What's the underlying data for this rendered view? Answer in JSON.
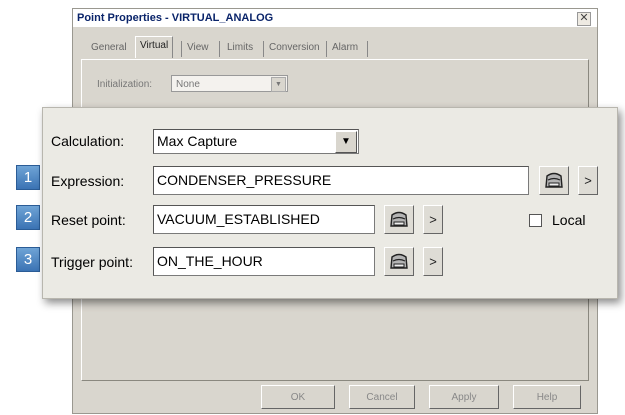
{
  "dialog": {
    "title": "Point Properties - VIRTUAL_ANALOG",
    "close_glyph": "✕",
    "tabs": [
      "General",
      "Virtual",
      "View",
      "Limits",
      "Conversion",
      "Alarm"
    ],
    "active_tab": "Virtual",
    "initialization": {
      "label": "Initialization:",
      "value": "None"
    },
    "buttons": {
      "ok": "OK",
      "cancel": "Cancel",
      "apply": "Apply",
      "help": "Help"
    }
  },
  "overlay": {
    "calculation": {
      "label": "Calculation:",
      "value": "Max Capture"
    },
    "expression": {
      "badge": "1",
      "label": "Expression:",
      "value": "CONDENSER_PRESSURE"
    },
    "reset_point": {
      "badge": "2",
      "label": "Reset point:",
      "value": "VACUUM_ESTABLISHED"
    },
    "trigger_point": {
      "badge": "3",
      "label": "Trigger point:",
      "value": "ON_THE_HOUR"
    },
    "local": {
      "label": "Local",
      "checked": false
    },
    "more_glyph": ">",
    "icons": {
      "browse": "tag-browser-icon",
      "dropdown": "chevron-down-icon"
    }
  }
}
